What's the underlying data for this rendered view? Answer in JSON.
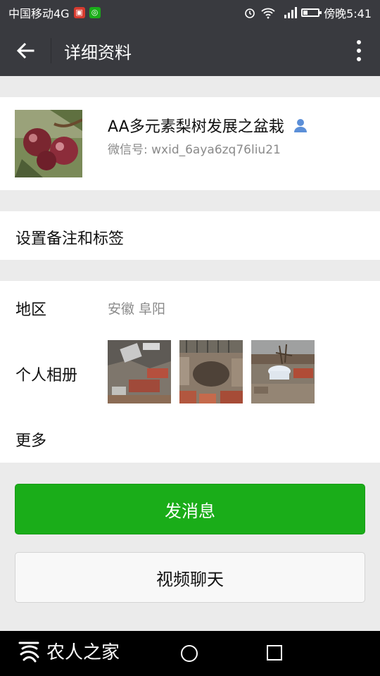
{
  "status_bar": {
    "carrier": "中国移动4G",
    "time": "傍晚5:41",
    "network": "4G"
  },
  "header": {
    "title": "详细资料"
  },
  "profile": {
    "name": "AA多元素梨树发展之盆栽",
    "wechat_id": "微信号: wxid_6aya6zq76liu21"
  },
  "remark": {
    "label": "设置备注和标签"
  },
  "details": {
    "region_label": "地区",
    "region_value": "安徽  阜阳",
    "album_label": "个人相册",
    "more_label": "更多"
  },
  "actions": {
    "send_message": "发消息",
    "video_call": "视频聊天"
  },
  "watermark": {
    "text": "农人之家"
  },
  "colors": {
    "topbar": "#393a3f",
    "primary_green": "#1aad19",
    "secondary_text": "#8a8a8a",
    "background": "#ebebeb"
  }
}
